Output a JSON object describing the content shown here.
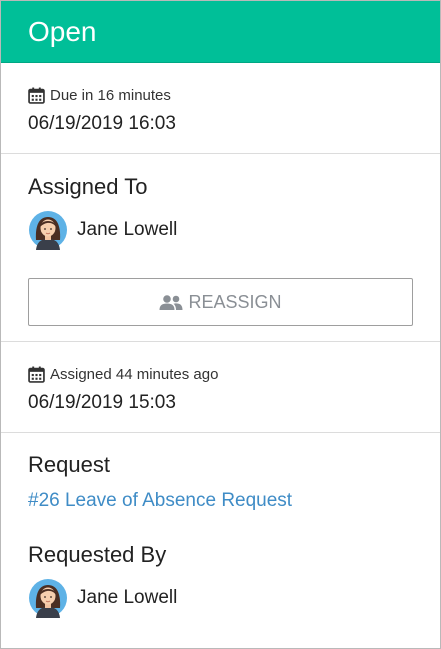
{
  "status": {
    "label": "Open"
  },
  "due": {
    "text": "Due in 16 minutes",
    "date": "06/19/2019 16:03",
    "icon": "calendar-icon"
  },
  "assigned": {
    "heading": "Assigned To",
    "user_name": "Jane Lowell",
    "reassign_label": "REASSIGN",
    "reassign_icon": "users-icon"
  },
  "assigned_time": {
    "text": "Assigned 44 minutes ago",
    "date": "06/19/2019 15:03",
    "icon": "calendar-icon"
  },
  "request": {
    "heading": "Request",
    "link_text": "#26 Leave of Absence Request",
    "requested_by_heading": "Requested By",
    "requester_name": "Jane Lowell"
  },
  "colors": {
    "status_bar": "#00bf98",
    "link": "#3f8cc6",
    "button_text": "#8a8f95"
  }
}
